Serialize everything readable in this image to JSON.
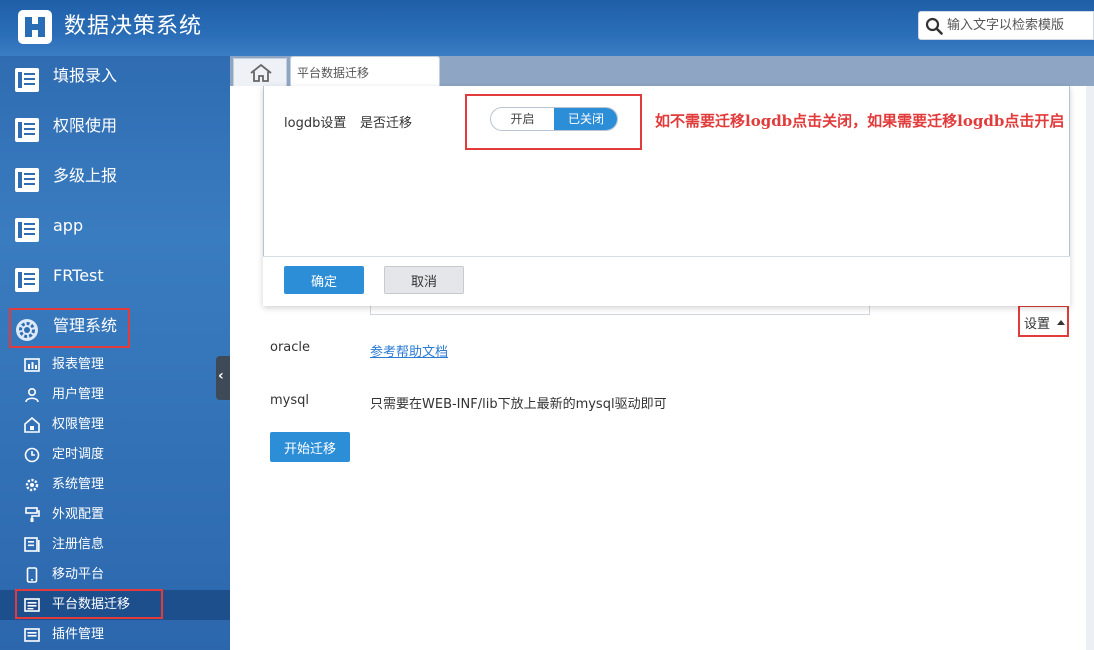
{
  "header": {
    "app_title": "数据决策系统",
    "search_placeholder": "输入文字以检索模版"
  },
  "sidebar": {
    "top_items": [
      {
        "label": "填报录入",
        "icon": "report-icon"
      },
      {
        "label": "权限使用",
        "icon": "report-icon"
      },
      {
        "label": "多级上报",
        "icon": "report-icon"
      },
      {
        "label": "app",
        "icon": "report-icon"
      },
      {
        "label": "FRTest",
        "icon": "report-icon"
      },
      {
        "label": "管理系统",
        "icon": "gear-icon"
      }
    ],
    "sub_items": [
      {
        "label": "报表管理",
        "icon": "report-manage-icon"
      },
      {
        "label": "用户管理",
        "icon": "user-icon"
      },
      {
        "label": "权限管理",
        "icon": "lock-icon"
      },
      {
        "label": "定时调度",
        "icon": "clock-icon"
      },
      {
        "label": "系统管理",
        "icon": "gear-icon"
      },
      {
        "label": "外观配置",
        "icon": "paint-roller-icon"
      },
      {
        "label": "注册信息",
        "icon": "register-icon"
      },
      {
        "label": "移动平台",
        "icon": "mobile-icon"
      },
      {
        "label": "平台数据迁移",
        "icon": "migrate-icon",
        "active": true
      },
      {
        "label": "插件管理",
        "icon": "plugin-icon"
      }
    ]
  },
  "tabs": {
    "current": "平台数据迁移"
  },
  "main": {
    "oracle_label": "oracle",
    "oracle_link": "参考帮助文档",
    "mysql_label": "mysql",
    "mysql_note": "只需要在WEB-INF/lib下放上最新的mysql驱动即可",
    "start_button": "开始迁移",
    "settings_label": "设置"
  },
  "dialog": {
    "logdb_label": "logdb设置",
    "migrate_label": "是否迁移",
    "toggle_on": "开启",
    "toggle_off": "已关闭",
    "toggle_state": "off",
    "confirm": "确定",
    "cancel": "取消"
  },
  "annotation": "如不需要迁移logdb点击关闭，如果需要迁移logdb点击开启",
  "colors": {
    "accent": "#2d8ed8",
    "highlight": "#e23b3b",
    "sidebar": "#3a7cc0"
  }
}
